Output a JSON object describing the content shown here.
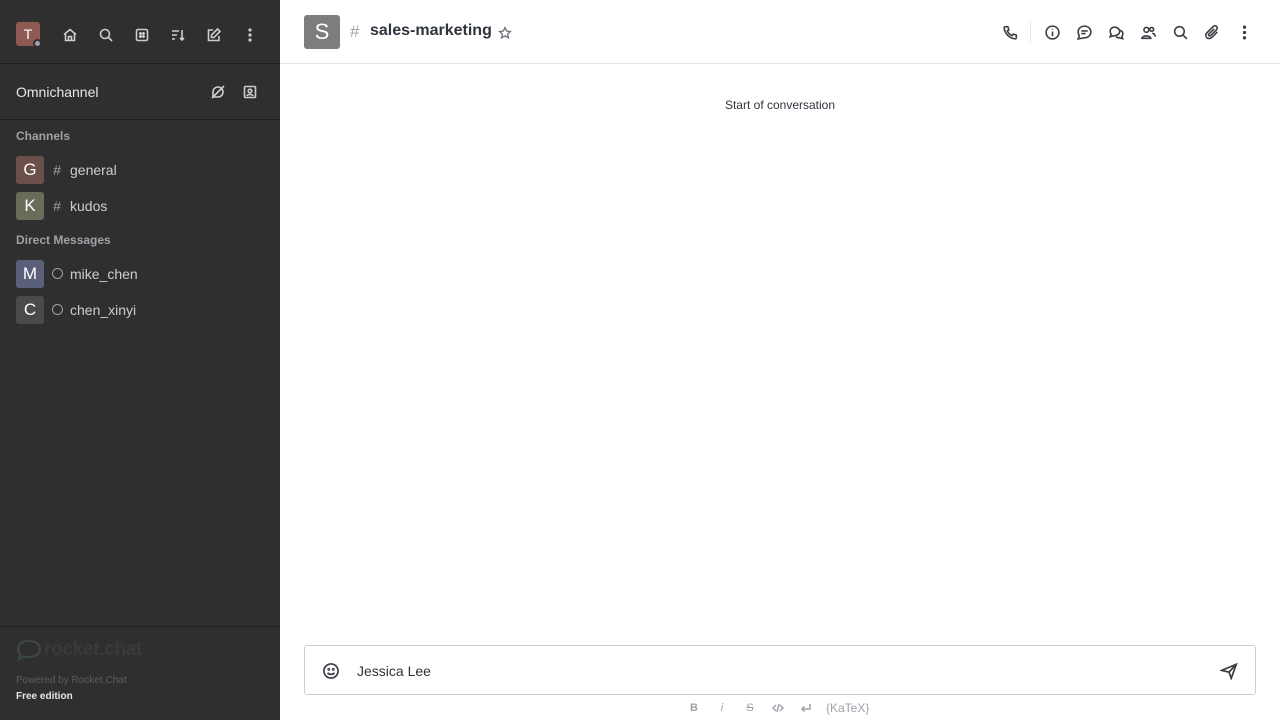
{
  "sidebar": {
    "user_avatar_letter": "T",
    "user_status": "offline",
    "toolbar_icons": [
      "home-icon",
      "search-icon",
      "directory-icon",
      "sort-icon",
      "create-new-icon",
      "kebab-menu-icon"
    ],
    "omnichannel": {
      "label": "Omnichannel",
      "icons": [
        "omnichannel-unavailable-icon",
        "contact-center-icon"
      ]
    },
    "channels_title": "Channels",
    "channels": [
      {
        "letter": "G",
        "name": "general",
        "avatar_color": "#6b4f4a"
      },
      {
        "letter": "K",
        "name": "kudos",
        "avatar_color": "#6b6b5a"
      }
    ],
    "dm_title": "Direct Messages",
    "direct_messages": [
      {
        "letter": "M",
        "name": "mike_chen",
        "avatar_color": "#5a5f7a"
      },
      {
        "letter": "C",
        "name": "chen_xinyi",
        "avatar_color": "#4a4a4a"
      }
    ],
    "footer": {
      "logo_text": "rocket.chat",
      "powered": "Powered by Rocket.Chat",
      "edition": "Free edition"
    }
  },
  "header": {
    "room_avatar_letter": "S",
    "room_name": "sales-marketing",
    "icons": [
      "call-icon",
      "room-info-icon",
      "threads-icon",
      "discussions-icon",
      "members-icon",
      "search-messages-icon",
      "files-icon",
      "kebab-menu-icon"
    ]
  },
  "main": {
    "start_text": "Start of conversation"
  },
  "composer": {
    "value": "Jessica Lee",
    "placeholder": "",
    "format_buttons": {
      "bold": "B",
      "italic": "i",
      "strike": "S",
      "katex": "{KaTeX}"
    }
  }
}
